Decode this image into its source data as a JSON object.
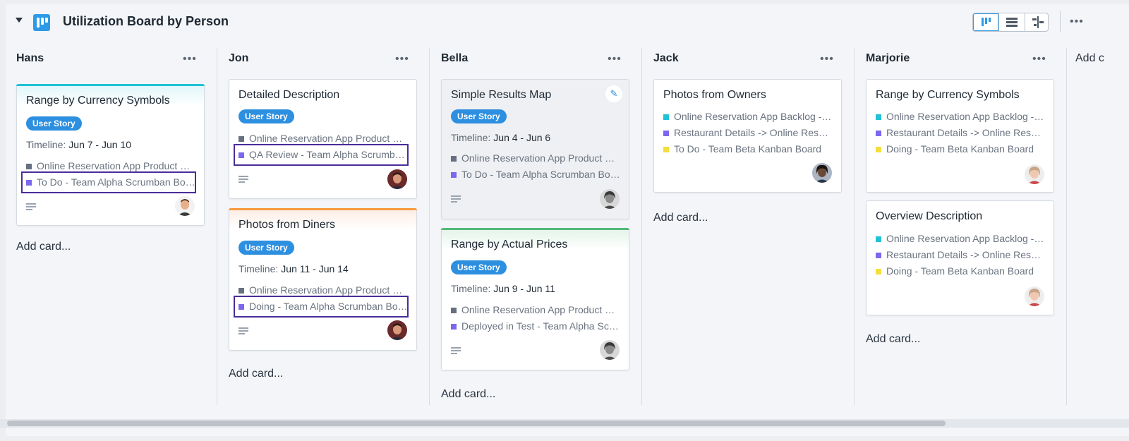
{
  "board": {
    "title": "Utilization Board by Person",
    "view_icons": [
      "kanban-view-icon",
      "table-view-icon",
      "timeline-view-icon"
    ],
    "accent": "#2d9ae8"
  },
  "add_card_label": "Add card...",
  "timeline_label": "Timeline:",
  "badge_label": "User Story",
  "columns": [
    {
      "name": "Hans",
      "cards": [
        {
          "title": "Range by Currency Symbols",
          "accent": "#21c2d6",
          "timeline": "Jun 7 - Jun 10",
          "links": [
            {
              "text": "Online Reservation App Product Backlog",
              "color": "#667080"
            },
            {
              "text": "To Do - Team Alpha Scrumban Board",
              "color": "#7b68ee"
            }
          ]
        }
      ]
    },
    {
      "name": "Jon",
      "cards": [
        {
          "title": "Detailed Description",
          "links": [
            {
              "text": "Online Reservation App Product Backlog",
              "color": "#667080"
            },
            {
              "text": "QA Review - Team Alpha Scrumban Board",
              "color": "#7b68ee"
            }
          ]
        },
        {
          "title": "Photos from Diners",
          "accent": "#f79a3e",
          "timeline": "Jun 11 - Jun 14",
          "links": [
            {
              "text": "Online Reservation App Product Backlog",
              "color": "#667080"
            },
            {
              "text": "Doing - Team Alpha Scrumban Board",
              "color": "#7b68ee"
            }
          ]
        }
      ]
    },
    {
      "name": "Bella",
      "cards": [
        {
          "title": "Simple Results Map",
          "timeline": "Jun 4 - Jun 6",
          "links": [
            {
              "text": "Online Reservation App Product Backlog",
              "color": "#667080"
            },
            {
              "text": "To Do - Team Alpha Scrumban Board",
              "color": "#7b68ee"
            }
          ]
        },
        {
          "title": "Range by Actual Prices",
          "accent": "#56b87a",
          "timeline": "Jun 9 - Jun 11",
          "links": [
            {
              "text": "Online Reservation App Product Backlog",
              "color": "#667080"
            },
            {
              "text": "Deployed in Test - Team Alpha Scrumban Board",
              "color": "#7b68ee"
            }
          ]
        }
      ]
    },
    {
      "name": "Jack",
      "cards": [
        {
          "title": "Photos from Owners",
          "links": [
            {
              "text": "Online Reservation App Backlog - Team Beta",
              "color": "#21c2d6"
            },
            {
              "text": "Restaurant Details -> Online Reservation App",
              "color": "#7b68ee"
            },
            {
              "text": "To Do - Team Beta Kanban Board",
              "color": "#f5de3b"
            }
          ]
        }
      ]
    },
    {
      "name": "Marjorie",
      "cards": [
        {
          "title": "Range by Currency Symbols",
          "links": [
            {
              "text": "Online Reservation App Backlog - Team Beta",
              "color": "#21c2d6"
            },
            {
              "text": "Restaurant Details -> Online Reservation App",
              "color": "#7b68ee"
            },
            {
              "text": "Doing - Team Beta Kanban Board",
              "color": "#f5de3b"
            }
          ]
        },
        {
          "title": "Overview Description",
          "links": [
            {
              "text": "Online Reservation App Backlog - Team Beta",
              "color": "#21c2d6"
            },
            {
              "text": "Restaurant Details -> Online Reservation App",
              "color": "#7b68ee"
            },
            {
              "text": "Doing - Team Beta Kanban Board",
              "color": "#f5de3b"
            }
          ]
        }
      ]
    }
  ],
  "partial_column_label": "Add c"
}
